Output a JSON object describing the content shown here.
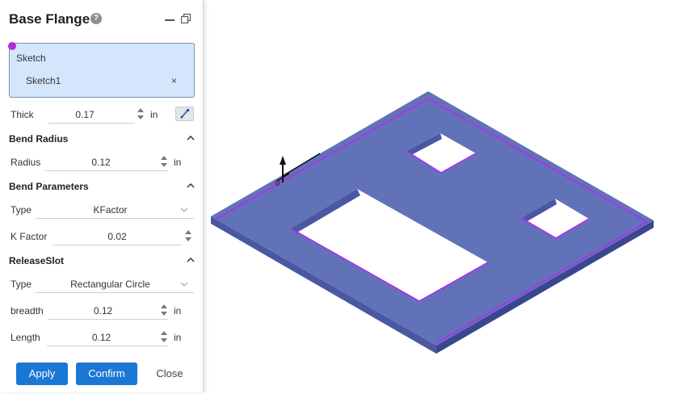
{
  "panel": {
    "title": "Base Flange",
    "help_glyph": "?",
    "sketch": {
      "label": "Sketch",
      "item": "Sketch1",
      "remove_glyph": "×"
    },
    "thick": {
      "label": "Thick",
      "value": "0.17",
      "unit": "in"
    },
    "bend_radius": {
      "heading": "Bend Radius",
      "radius": {
        "label": "Radius",
        "value": "0.12",
        "unit": "in"
      }
    },
    "bend_parameters": {
      "heading": "Bend Parameters",
      "type": {
        "label": "Type",
        "value": "KFactor"
      },
      "k_factor": {
        "label": "K Factor",
        "value": "0.02"
      }
    },
    "release_slot": {
      "heading": "ReleaseSlot",
      "type": {
        "label": "Type",
        "value": "Rectangular Circle"
      },
      "breadth": {
        "label": "breadth",
        "value": "0.12",
        "unit": "in"
      },
      "length": {
        "label": "Length",
        "value": "0.12",
        "unit": "in"
      }
    },
    "buttons": {
      "apply": "Apply",
      "confirm": "Confirm",
      "close": "Close"
    }
  },
  "colors": {
    "plate_top": "#6272b8",
    "plate_edge": "#4a57a2",
    "outline": "#b22cf0",
    "selection_bg": "#d4e6fb",
    "primary_button": "#1a78d4"
  },
  "icons": [
    "help-icon",
    "minimize-icon",
    "restore-icon",
    "close-icon",
    "spinner-icon",
    "chevron-up-icon",
    "chevron-down-icon",
    "pick-icon",
    "axis-triad-icon"
  ]
}
